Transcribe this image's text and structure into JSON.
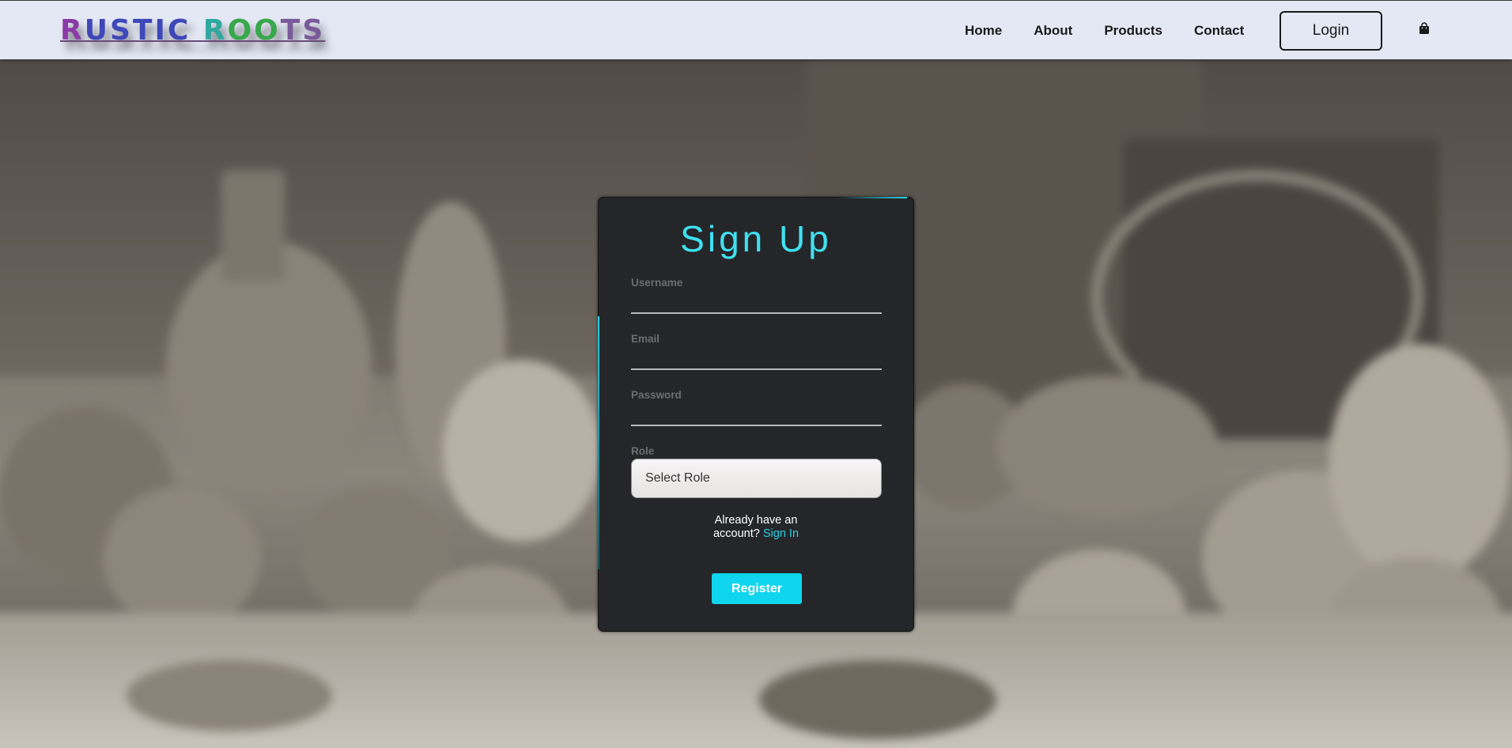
{
  "brand": {
    "logo_text": "RUSTIC ROOTS",
    "logo_colors": [
      "#8b3aa8",
      "#3f48b8",
      "#2ea8a0",
      "#38a84a",
      "#7a5a9a"
    ]
  },
  "nav": {
    "links": [
      {
        "label": "Home"
      },
      {
        "label": "About"
      },
      {
        "label": "Products"
      },
      {
        "label": "Contact"
      }
    ],
    "login_label": "Login",
    "cart_icon": "shopping-bag-icon"
  },
  "form": {
    "title": "Sign Up",
    "fields": [
      {
        "label": "Username",
        "value": ""
      },
      {
        "label": "Email",
        "value": ""
      },
      {
        "label": "Password",
        "value": ""
      }
    ],
    "role": {
      "label": "Role",
      "selected": "Select Role"
    },
    "already_text_1": "Already have an",
    "already_text_2": "account?",
    "signin_label": "Sign In",
    "register_label": "Register"
  },
  "colors": {
    "accent": "#26d3e6",
    "card_bg": "#25262a",
    "navbar_bg": "#e4e8f4",
    "register_bg": "#0fd5ee"
  }
}
